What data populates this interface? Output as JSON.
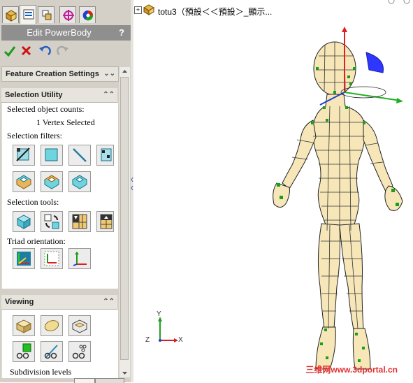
{
  "panel": {
    "title": "Edit PowerBody",
    "help": "?",
    "actions": [
      "ok-icon",
      "cancel-icon",
      "undo-icon",
      "redo-icon"
    ]
  },
  "sections": {
    "feature_creation": {
      "label": "Feature Creation Settings",
      "chevron": "⌄⌄"
    },
    "selection_utility": {
      "label": "Selection Utility",
      "chevron": "⌃⌃",
      "counts_label": "Selected object counts:",
      "counts_value": "1 Vertex Selected",
      "filters_label": "Selection filters:",
      "tools_label": "Selection tools:",
      "triad_label": "Triad orientation:"
    },
    "viewing": {
      "label": "Viewing",
      "chevron": "⌃⌃",
      "subdivision_label": "Subdivision levels"
    }
  },
  "tree": {
    "expander": "+",
    "item_label": "totu3（預設＜＜預設＞_顯示..."
  },
  "axes": {
    "y": "Y",
    "x": "X",
    "z": "Z"
  },
  "watermark": "三维网www.3dportal.cn",
  "colors": {
    "accent_blue": "#1560bd",
    "title_gray": "#8f8f8f",
    "check_green": "#1a9a1a",
    "cancel_red": "#cc1111"
  }
}
